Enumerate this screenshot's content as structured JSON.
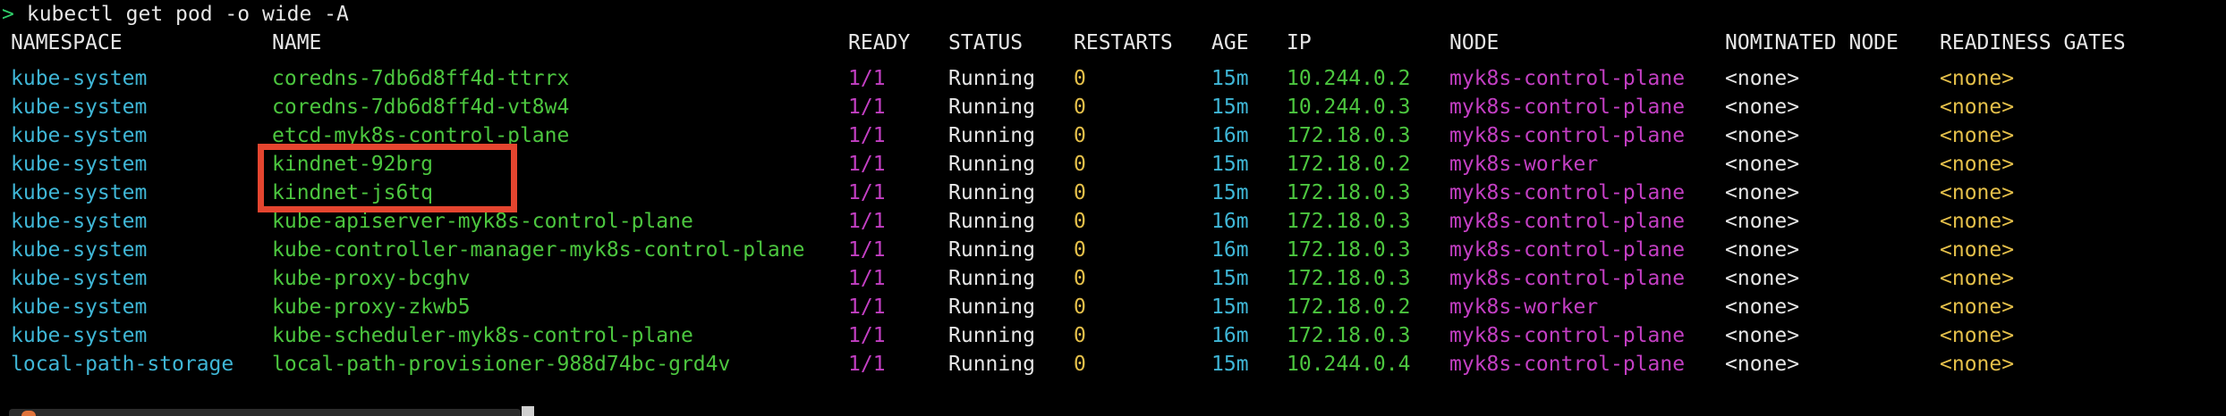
{
  "colors": {
    "namespace": "#3fb6d6",
    "name": "#4cc63f",
    "ready": "#c33fc3",
    "status": "#e6e6e6",
    "restarts": "#e5c04a",
    "age": "#3fb6d6",
    "ip": "#4cc63f",
    "node": "#c33fc3",
    "nominated": "#e6e6e6",
    "gates": "#e5c04a",
    "highlight": "#e5452f"
  },
  "terminal": {
    "prompt_symbol": ">",
    "command": " kubectl get pod -o wide -A"
  },
  "table": {
    "headers": {
      "namespace": "NAMESPACE",
      "name": "NAME",
      "ready": "READY",
      "status": "STATUS",
      "restarts": "RESTARTS",
      "age": "AGE",
      "ip": "IP",
      "node": "NODE",
      "nominated": "NOMINATED NODE",
      "gates": "READINESS GATES"
    },
    "rows": [
      {
        "namespace": "kube-system",
        "name": "coredns-7db6d8ff4d-ttrrx",
        "ready": "1/1",
        "status": "Running",
        "restarts": "0",
        "age": "15m",
        "ip": "10.244.0.2",
        "node": "myk8s-control-plane",
        "nominated": "<none>",
        "gates": "<none>"
      },
      {
        "namespace": "kube-system",
        "name": "coredns-7db6d8ff4d-vt8w4",
        "ready": "1/1",
        "status": "Running",
        "restarts": "0",
        "age": "15m",
        "ip": "10.244.0.3",
        "node": "myk8s-control-plane",
        "nominated": "<none>",
        "gates": "<none>"
      },
      {
        "namespace": "kube-system",
        "name": "etcd-myk8s-control-plane",
        "ready": "1/1",
        "status": "Running",
        "restarts": "0",
        "age": "16m",
        "ip": "172.18.0.3",
        "node": "myk8s-control-plane",
        "nominated": "<none>",
        "gates": "<none>"
      },
      {
        "namespace": "kube-system",
        "name": "kindnet-92brg",
        "ready": "1/1",
        "status": "Running",
        "restarts": "0",
        "age": "15m",
        "ip": "172.18.0.2",
        "node": "myk8s-worker",
        "nominated": "<none>",
        "gates": "<none>"
      },
      {
        "namespace": "kube-system",
        "name": "kindnet-js6tq",
        "ready": "1/1",
        "status": "Running",
        "restarts": "0",
        "age": "15m",
        "ip": "172.18.0.3",
        "node": "myk8s-control-plane",
        "nominated": "<none>",
        "gates": "<none>"
      },
      {
        "namespace": "kube-system",
        "name": "kube-apiserver-myk8s-control-plane",
        "ready": "1/1",
        "status": "Running",
        "restarts": "0",
        "age": "16m",
        "ip": "172.18.0.3",
        "node": "myk8s-control-plane",
        "nominated": "<none>",
        "gates": "<none>"
      },
      {
        "namespace": "kube-system",
        "name": "kube-controller-manager-myk8s-control-plane",
        "ready": "1/1",
        "status": "Running",
        "restarts": "0",
        "age": "16m",
        "ip": "172.18.0.3",
        "node": "myk8s-control-plane",
        "nominated": "<none>",
        "gates": "<none>"
      },
      {
        "namespace": "kube-system",
        "name": "kube-proxy-bcghv",
        "ready": "1/1",
        "status": "Running",
        "restarts": "0",
        "age": "15m",
        "ip": "172.18.0.3",
        "node": "myk8s-control-plane",
        "nominated": "<none>",
        "gates": "<none>"
      },
      {
        "namespace": "kube-system",
        "name": "kube-proxy-zkwb5",
        "ready": "1/1",
        "status": "Running",
        "restarts": "0",
        "age": "15m",
        "ip": "172.18.0.2",
        "node": "myk8s-worker",
        "nominated": "<none>",
        "gates": "<none>"
      },
      {
        "namespace": "kube-system",
        "name": "kube-scheduler-myk8s-control-plane",
        "ready": "1/1",
        "status": "Running",
        "restarts": "0",
        "age": "16m",
        "ip": "172.18.0.3",
        "node": "myk8s-control-plane",
        "nominated": "<none>",
        "gates": "<none>"
      },
      {
        "namespace": "local-path-storage",
        "name": "local-path-provisioner-988d74bc-grd4v",
        "ready": "1/1",
        "status": "Running",
        "restarts": "0",
        "age": "15m",
        "ip": "10.244.0.4",
        "node": "myk8s-control-plane",
        "nominated": "<none>",
        "gates": "<none>"
      }
    ]
  },
  "highlight": {
    "icon": "highlight-box"
  }
}
